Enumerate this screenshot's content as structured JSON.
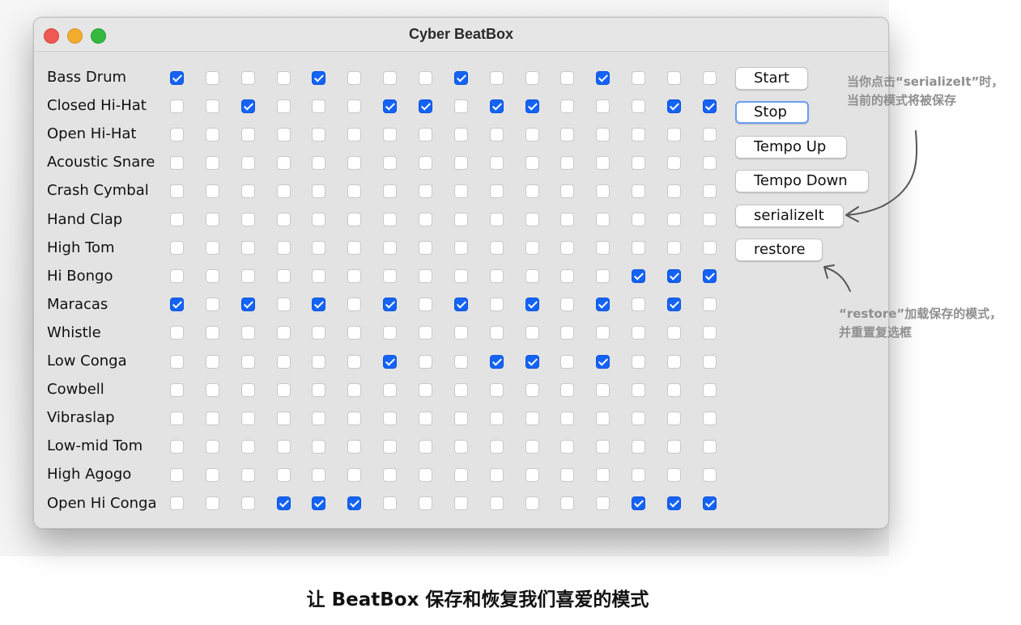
{
  "window": {
    "title": "Cyber BeatBox"
  },
  "instruments": [
    "Bass Drum",
    "Closed Hi-Hat",
    "Open Hi-Hat",
    "Acoustic Snare",
    "Crash Cymbal",
    "Hand Clap",
    "High Tom",
    "Hi Bongo",
    "Maracas",
    "Whistle",
    "Low Conga",
    "Cowbell",
    "Vibraslap",
    "Low-mid Tom",
    "High Agogo",
    "Open Hi Conga"
  ],
  "pattern": [
    "1000100010001000",
    "0010001101100011",
    "0000000000000000",
    "0000000000000000",
    "0000000000000000",
    "0000000000000000",
    "0000000000000000",
    "0000000000000111",
    "1010101010101010",
    "0000000000000000",
    "0000001001101000",
    "0000000000000000",
    "0000000000000000",
    "0000000000000000",
    "0000000000000000",
    "0001110000000111"
  ],
  "buttons": {
    "start": "Start",
    "stop": "Stop",
    "tempo_up": "Tempo Up",
    "tempo_down": "Tempo Down",
    "serialize": "serializeIt",
    "restore": "restore"
  },
  "annotations": {
    "serialize_line1": "当你点击“serializeIt”时，",
    "serialize_line2": "当前的模式将被保存",
    "restore_line1": "“restore”加载保存的模式，",
    "restore_line2": "并重置复选框"
  },
  "caption": "让 BeatBox 保存和恢复我们喜爱的模式",
  "colors": {
    "checked": "#1463f5",
    "annotation": "#8f8f8f",
    "window_bg": "#e3e3e3"
  }
}
